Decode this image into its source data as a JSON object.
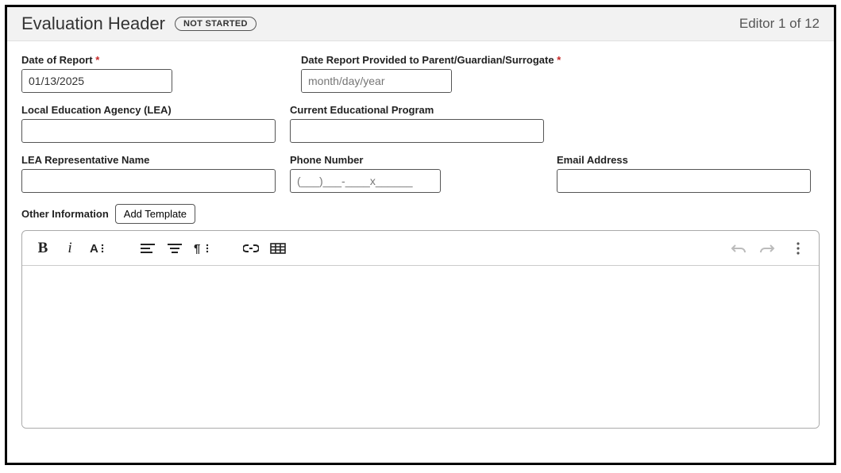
{
  "header": {
    "title": "Evaluation Header",
    "status": "NOT STARTED",
    "editor_count": "Editor 1 of 12"
  },
  "fields": {
    "date_of_report": {
      "label": "Date of Report",
      "value": "01/13/2025",
      "required": true
    },
    "date_provided": {
      "label": "Date Report Provided to Parent/Guardian/Surrogate",
      "placeholder": "month/day/year",
      "value": "",
      "required": true
    },
    "lea": {
      "label": "Local Education Agency (LEA)",
      "value": ""
    },
    "program": {
      "label": "Current Educational Program",
      "value": ""
    },
    "rep_name": {
      "label": "LEA Representative Name",
      "value": ""
    },
    "phone": {
      "label": "Phone Number",
      "placeholder": "(___)___-____x______",
      "value": ""
    },
    "email": {
      "label": "Email Address",
      "value": ""
    },
    "other": {
      "label": "Other Information",
      "add_template": "Add Template",
      "content": ""
    }
  }
}
